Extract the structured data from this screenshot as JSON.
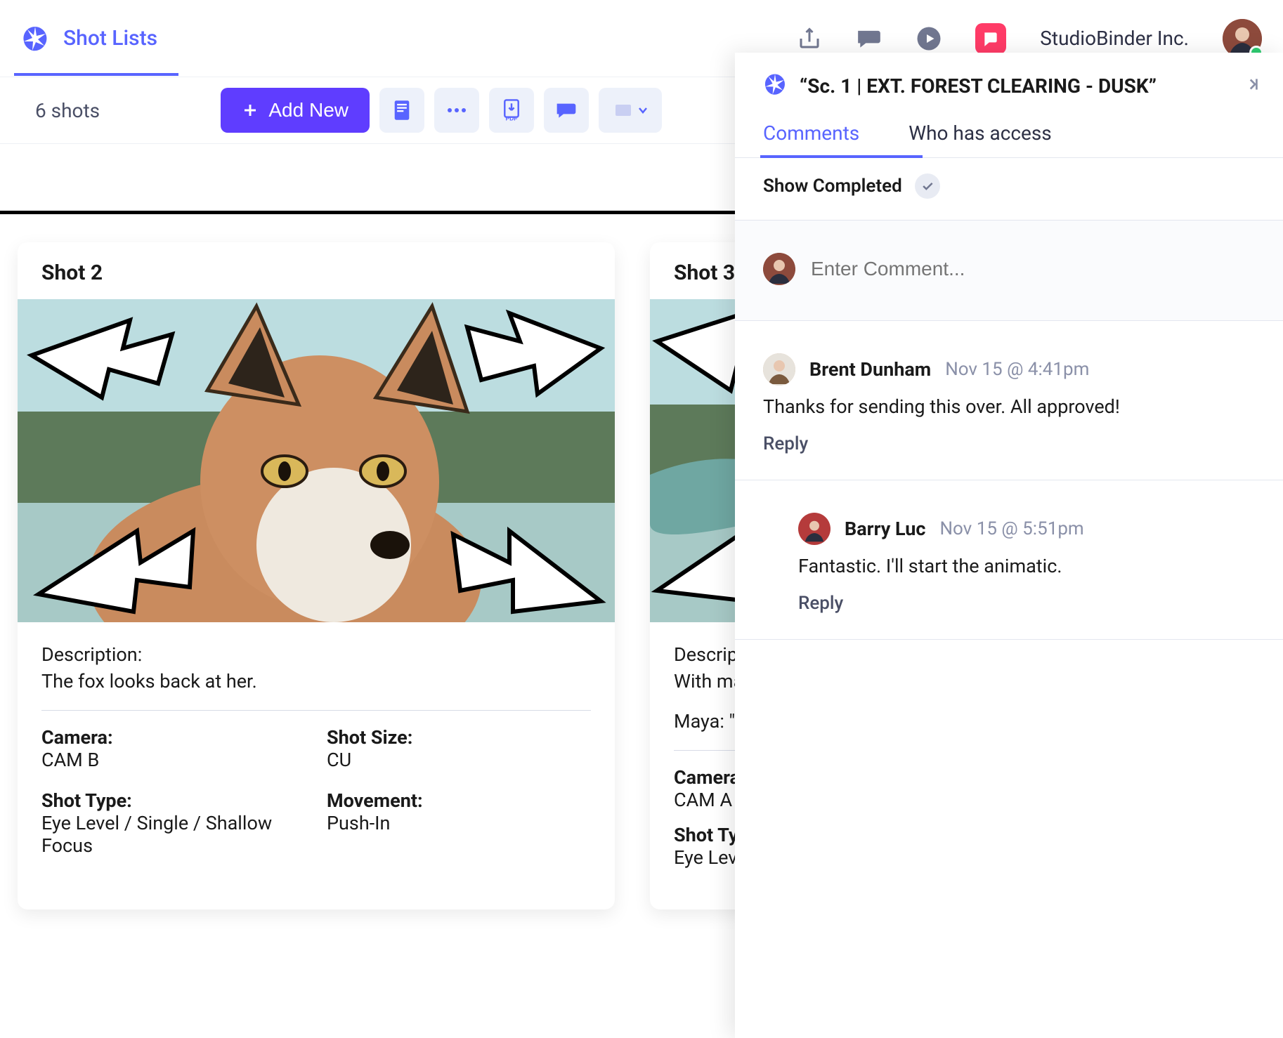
{
  "topbar": {
    "tab_label": "Shot Lists",
    "org_name": "StudioBinder Inc."
  },
  "toolbar": {
    "shot_count": "6 shots",
    "add_new_label": "Add New"
  },
  "shots": [
    {
      "title": "Shot  2",
      "description_label": "Description:",
      "description_text": "The fox looks back at her.",
      "fields": {
        "camera_label": "Camera:",
        "camera_value": "CAM B",
        "size_label": "Shot Size:",
        "size_value": "CU",
        "type_label": "Shot Type:",
        "type_value": "Eye Level / Single / Shallow Focus",
        "movement_label": "Movement:",
        "movement_value": "Push-In"
      }
    },
    {
      "title": "Shot  3",
      "description_label": "Descripti",
      "description_text": "With ma",
      "dialogue": "Maya: \"E",
      "fields": {
        "camera_label": "Camera:",
        "camera_value": "CAM A",
        "type_label": "Shot Typ",
        "type_value": "Eye Leve"
      }
    }
  ],
  "panel": {
    "title": "“Sc. 1 | EXT. FOREST CLEARING - DUSK”",
    "tabs": {
      "comments": "Comments",
      "access": "Who has access"
    },
    "show_completed": "Show Completed",
    "entry_placeholder": "Enter Comment...",
    "comments": [
      {
        "author": "Brent Dunham",
        "timestamp": "Nov 15 @ 4:41pm",
        "text": "Thanks for sending this over. All approved!",
        "reply_label": "Reply",
        "avatar_bg": "#d9bfa8"
      },
      {
        "author": "Barry Luc",
        "timestamp": "Nov 15 @ 5:51pm",
        "text": "Fantastic. I'll start the animatic.",
        "reply_label": "Reply",
        "avatar_bg": "#b53b3b"
      }
    ]
  }
}
